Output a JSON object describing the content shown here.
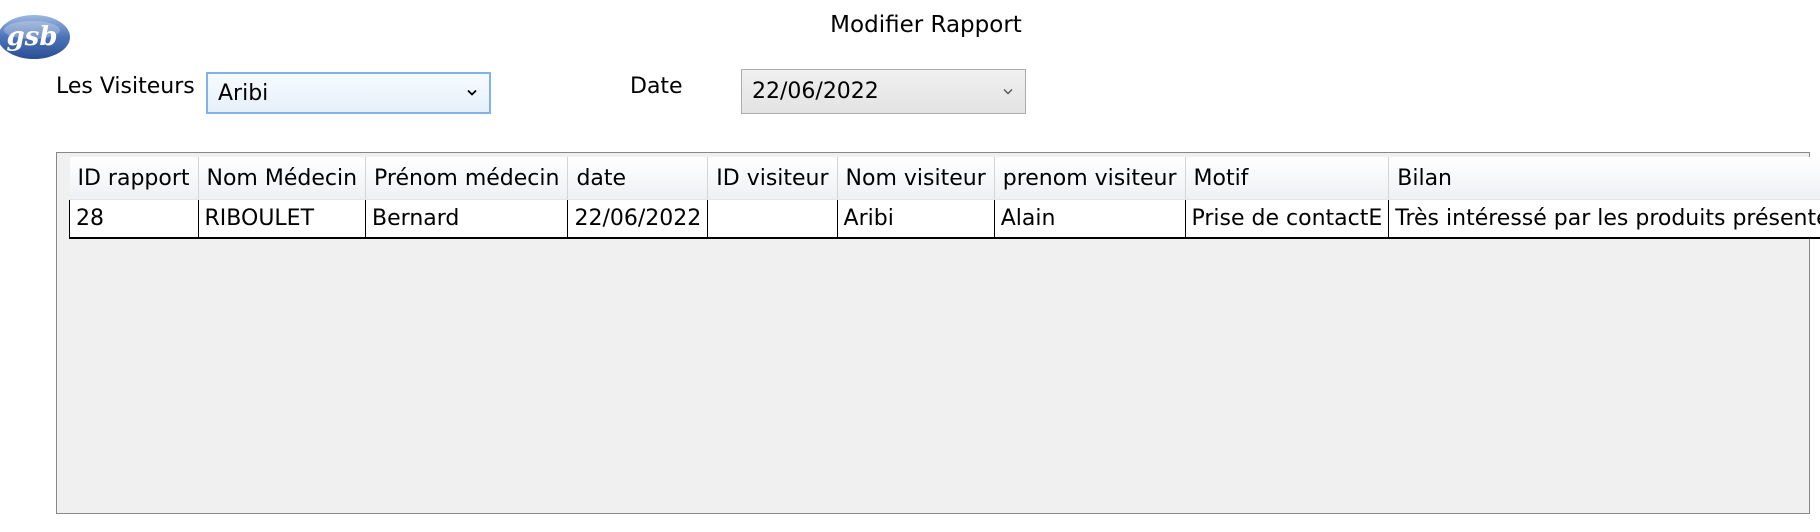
{
  "logo": {
    "text": "gsb"
  },
  "window": {
    "title": "Modifier Rapport"
  },
  "filters": {
    "visiteurs_label": "Les Visiteurs",
    "visiteurs_value": "Aribi",
    "date_label": "Date",
    "date_value": "22/06/2022"
  },
  "colors": {
    "combo_focus_border": "#7eb4ea",
    "grid_background": "#f0f0f0",
    "logo_blue": "#3a62a7"
  },
  "table": {
    "columns": [
      "ID rapport",
      "Nom Médecin",
      "Prénom médecin",
      "date",
      "ID visiteur",
      "Nom visiteur",
      "prenom visiteur",
      "Motif",
      "Bilan"
    ],
    "rows": [
      [
        "28",
        "RIBOULET",
        "Bernard",
        "22/06/2022",
        "",
        "Aribi",
        "Alain",
        "Prise de contactE",
        "Très intéressé par les produits présentés"
      ]
    ]
  }
}
